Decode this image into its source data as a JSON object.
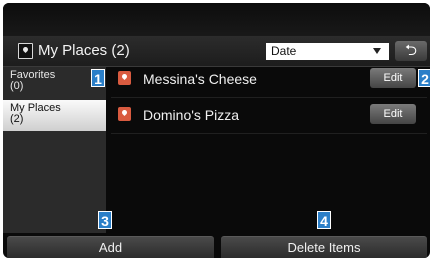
{
  "header": {
    "title": "My Places (2)",
    "sort_value": "Date",
    "back_symbol": "⮌"
  },
  "sidebar": {
    "items": [
      {
        "label_line1": "Favorites",
        "label_line2": "(0)",
        "active": false
      },
      {
        "label_line1": "My Places",
        "label_line2": "(2)",
        "active": true
      }
    ]
  },
  "places": [
    {
      "name": "Messina's Cheese",
      "edit_label": "Edit"
    },
    {
      "name": "Domino's Pizza",
      "edit_label": "Edit"
    }
  ],
  "footer": {
    "add_label": "Add",
    "delete_label": "Delete Items"
  },
  "callouts": [
    "1",
    "2",
    "3",
    "4"
  ],
  "colors": {
    "callout": "#2b7fc8",
    "pin": "#d95b40",
    "active_tab": "#e6e6e6"
  }
}
